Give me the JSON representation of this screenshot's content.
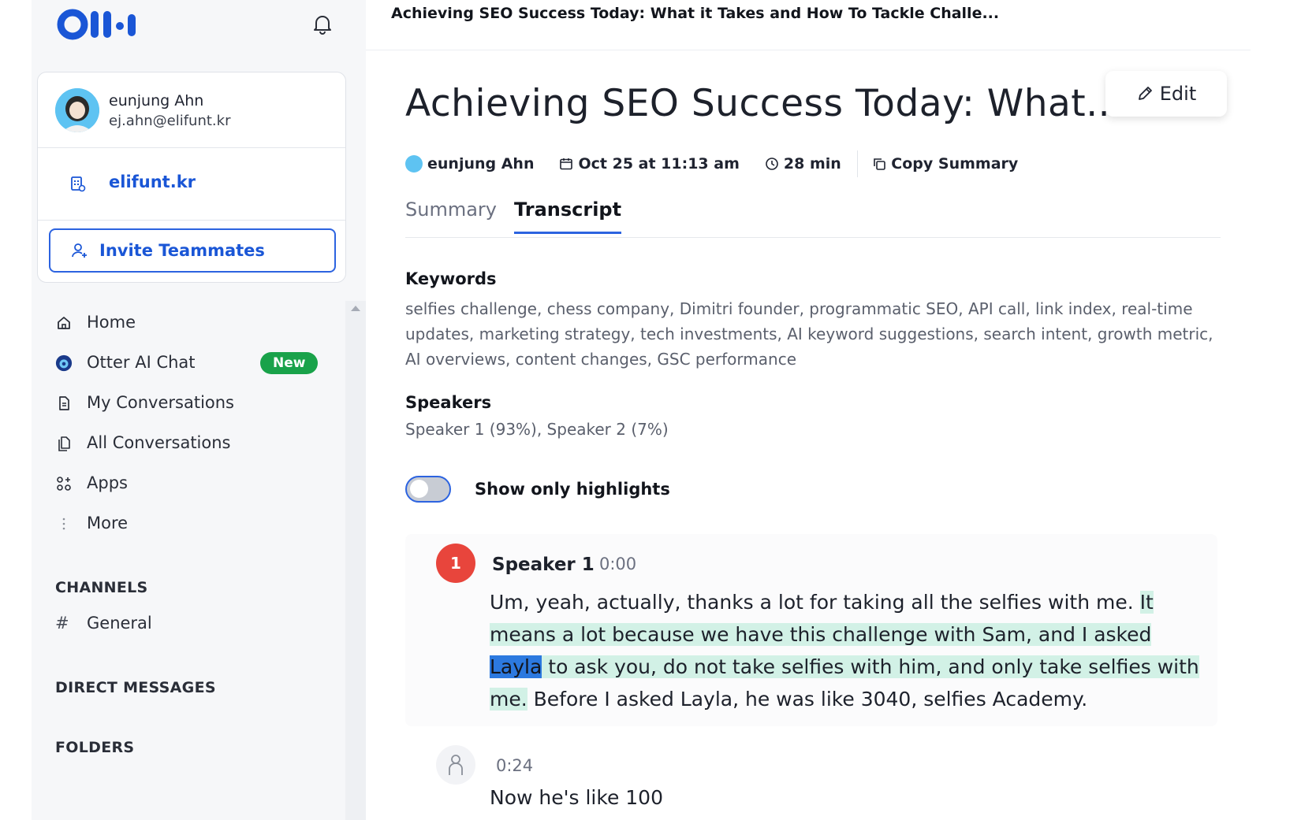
{
  "app": {
    "brand": "Otter"
  },
  "sidebar": {
    "user": {
      "name": "eunjung Ahn",
      "email": "ej.ahn@elifunt.kr"
    },
    "workspace": {
      "label": "elifunt.kr"
    },
    "invite_label": "Invite Teammates",
    "nav": [
      {
        "label": "Home",
        "icon": "home-icon"
      },
      {
        "label": "Otter AI Chat",
        "icon": "otter-chat-icon",
        "badge": "New"
      },
      {
        "label": "My Conversations",
        "icon": "document-icon"
      },
      {
        "label": "All Conversations",
        "icon": "documents-icon"
      },
      {
        "label": "Apps",
        "icon": "apps-icon"
      },
      {
        "label": "More",
        "icon": "more-icon"
      }
    ],
    "channels_heading": "CHANNELS",
    "channels": [
      {
        "hash": "#",
        "label": "General"
      }
    ],
    "dm_heading": "DIRECT MESSAGES",
    "folders_heading": "FOLDERS"
  },
  "main": {
    "title_bar": "Achieving SEO Success Today: What it Takes and How To Tackle Challe...",
    "page_title": "Achieving SEO Success Today: What...",
    "edit_label": "Edit",
    "meta": {
      "author": "eunjung Ahn",
      "date": "Oct 25 at 11:13 am",
      "duration": "28 min",
      "copy_label": "Copy Summary"
    },
    "tabs": [
      {
        "label": "Summary",
        "active": false
      },
      {
        "label": "Transcript",
        "active": true
      }
    ],
    "keywords_heading": "Keywords",
    "keywords": "selfies challenge, chess company, Dimitri founder, programmatic SEO, API call, link index, real-time updates, marketing strategy, tech investments, AI keyword suggestions, search intent, growth metric, AI overviews, content changes, GSC performance",
    "speakers_heading": "Speakers",
    "speakers": "Speaker 1 (93%), Speaker 2 (7%)",
    "highlights_toggle": {
      "label": "Show only highlights",
      "on": false
    },
    "segments": [
      {
        "badge": "1",
        "speaker": "Speaker 1",
        "time": "0:00",
        "text_plain": "Um, yeah, actually, thanks a lot for taking all the selfies with me.",
        "text_hl_a": "It means a lot because we have this challenge with Sam, and I asked",
        "text_selected": "Layla",
        "text_hl_b": "to ask you, do not take selfies with him, and only take selfies with me.",
        "text_tail": "Before I asked Layla, he was like 3040, selfies Academy."
      },
      {
        "time": "0:24",
        "text": "Now he's like 100"
      }
    ]
  },
  "colors": {
    "accent": "#2c63e0",
    "badge_green": "#19a24a",
    "speaker_red": "#e8453c",
    "highlight": "#d2f1e6",
    "selection": "#2c79df"
  }
}
